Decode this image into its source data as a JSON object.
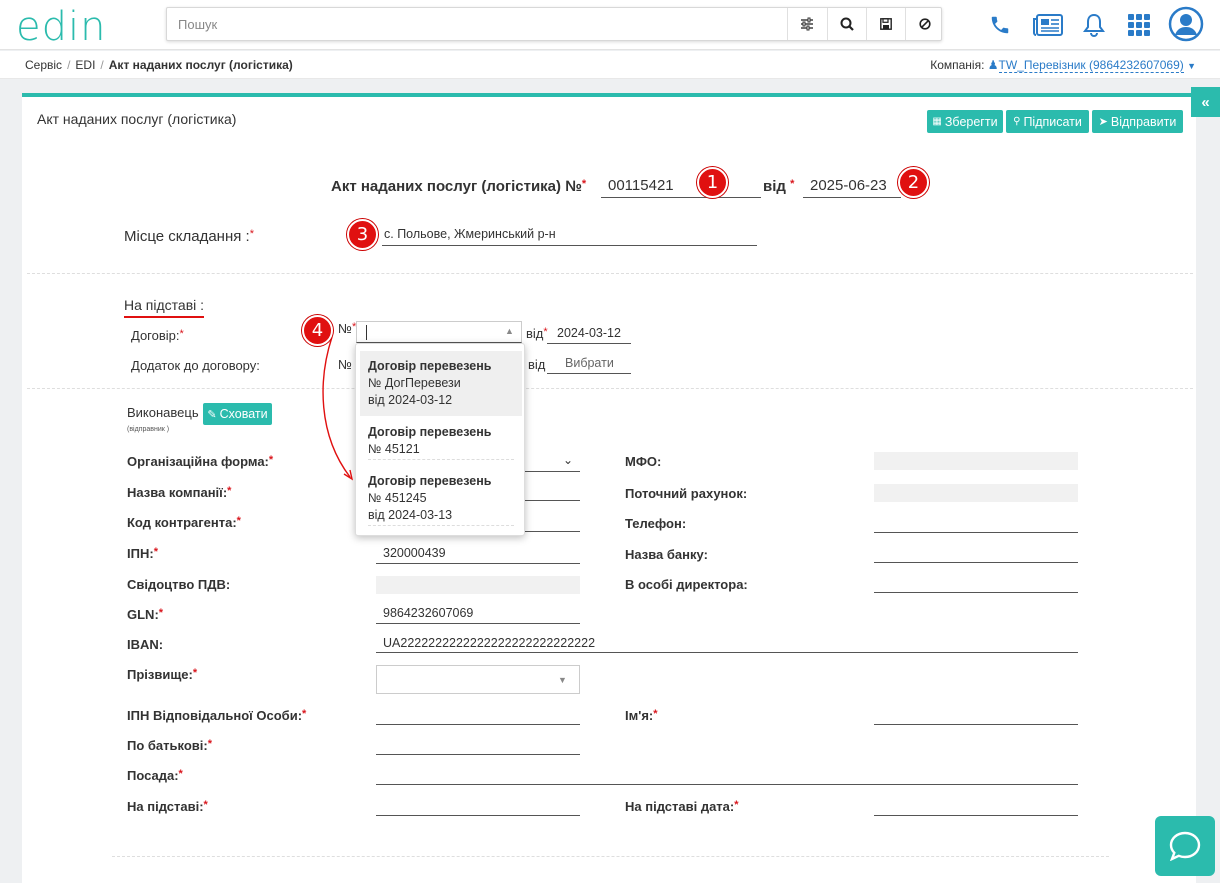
{
  "header": {
    "logo_text": "edin",
    "search_placeholder": "Пошук",
    "search_buttons": [
      "filter-icon",
      "search-icon",
      "save-icon",
      "clear-icon"
    ],
    "right_icons": [
      "phone-icon",
      "news-icon",
      "bell-icon",
      "apps-grid-icon",
      "user-avatar-icon"
    ]
  },
  "breadcrumb": {
    "items": [
      "Сервіс",
      "EDI"
    ],
    "current": "Акт наданих послуг (логістика)",
    "company_label": "Компанія:",
    "company_value": "TW_Перевізник (9864232607069)"
  },
  "card": {
    "title": "Акт наданих послуг (логістика)",
    "buttons": {
      "save": "Зберегти",
      "sign": "Підписати",
      "send": "Відправити"
    }
  },
  "document": {
    "heading": "Акт наданих послуг (логістика) №",
    "number": "00115421",
    "date_label": "від",
    "date": "2025-06-23",
    "place_label": "Місце складання :",
    "place": "с. Польове, Жмеринський р-н"
  },
  "basis": {
    "section_label": "На підставі :",
    "contract_label": "Договір:",
    "no_label": "№",
    "date_label": "від",
    "contract_date": "2024-03-12",
    "addendum_label": "Додаток до договору:",
    "addendum_date_placeholder": "Вибрати"
  },
  "dropdown": {
    "items": [
      {
        "title": "Договір перевезень",
        "line1": "№ ДогПеревези",
        "line2": "від 2024-03-12"
      },
      {
        "title": "Договір перевезень",
        "line1": "№ 45121",
        "line2": ""
      },
      {
        "title": "Договір перевезень",
        "line1": "№ 451245",
        "line2": "від 2024-03-13"
      }
    ]
  },
  "executor": {
    "label": "Виконавець",
    "sublabel": "(відправник )",
    "hide_button": "Сховати",
    "fields": {
      "org_form": "Організаційна форма:",
      "company_name": "Назва компанії:",
      "contractor_code": "Код контрагента:",
      "ipn": "ІПН:",
      "ipn_value": "320000439",
      "vat_cert": "Свідоцтво ПДВ:",
      "gln": "GLN:",
      "gln_value": "9864232607069",
      "iban": "IBAN:",
      "iban_value": "UA2222222222222222222222222222",
      "surname": "Прізвище:",
      "responsible_ipn": "ІПН Відповідальної Особи:",
      "patronymic": "По батькові:",
      "position": "Посада:",
      "basis": "На підставі:",
      "mfo": "МФО:",
      "account": "Поточний рахунок:",
      "phone": "Телефон:",
      "bank": "Назва банку:",
      "director": "В особі директора:",
      "first_name": "Ім'я:",
      "basis_date": "На підставі дата:"
    }
  },
  "annotations": [
    "1",
    "2",
    "3",
    "4"
  ],
  "colors": {
    "accent": "#2bbbad",
    "link": "#2a7bc8",
    "required": "#d9161d",
    "badge": "#e01010"
  }
}
